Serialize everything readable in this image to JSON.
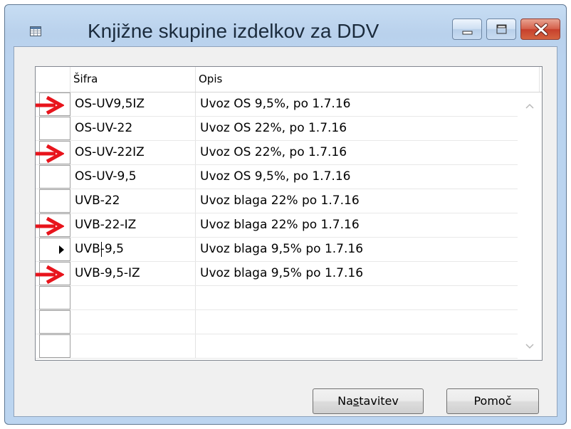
{
  "window": {
    "title": "Knjižne skupine izdelkov za DDV",
    "icon": "table-grid-icon"
  },
  "caption_buttons": {
    "minimize_icon": "minimize-icon",
    "maximize_icon": "maximize-icon",
    "close_icon": "close-icon",
    "close_color": "#c7402c"
  },
  "grid": {
    "columns": [
      "Šifra",
      "Opis"
    ],
    "rows": [
      {
        "code": "OS-UV9,5IZ",
        "description": "Uvoz OS 9,5%, po 1.7.16",
        "marked": true,
        "current": false
      },
      {
        "code": "OS-UV-22",
        "description": "Uvoz OS 22%, po 1.7.16",
        "marked": false,
        "current": false
      },
      {
        "code": "OS-UV-22IZ",
        "description": "Uvoz OS 22%, po 1.7.16",
        "marked": true,
        "current": false
      },
      {
        "code": "OS-UV-9,5",
        "description": "Uvoz OS 9,5%, po 1.7.16",
        "marked": false,
        "current": false
      },
      {
        "code": "UVB-22",
        "description": "Uvoz blaga 22% po 1.7.16",
        "marked": false,
        "current": false
      },
      {
        "code": "UVB-22-IZ",
        "description": "Uvoz blaga 22% po 1.7.16",
        "marked": true,
        "current": false
      },
      {
        "code": "UVB-9,5",
        "description": "Uvoz blaga 9,5% po 1.7.16",
        "marked": false,
        "current": true
      },
      {
        "code": "UVB-9,5-IZ",
        "description": "Uvoz blaga 9,5% po 1.7.16",
        "marked": true,
        "current": false
      },
      {
        "code": "",
        "description": "",
        "marked": false,
        "current": false
      },
      {
        "code": "",
        "description": "",
        "marked": false,
        "current": false
      },
      {
        "code": "",
        "description": "",
        "marked": false,
        "current": false
      }
    ],
    "annotation_arrow_color": "#e8141c"
  },
  "buttons": {
    "setup": {
      "pre": "Na",
      "mnemonic": "s",
      "post": "tavitev"
    },
    "help": {
      "label": "Pomoč"
    }
  }
}
